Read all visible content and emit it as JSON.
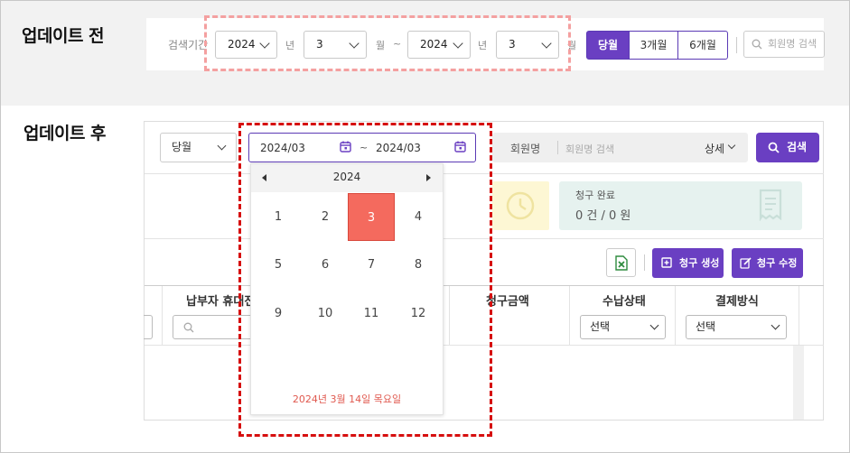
{
  "before": {
    "title": "업데이트 전",
    "period_label": "검색기간",
    "start_year": "2024",
    "year_unit": "년",
    "start_month": "3",
    "month_unit": "월",
    "range_sep": "~",
    "end_year": "2024",
    "end_month": "3",
    "period_buttons": [
      "당월",
      "3개월",
      "6개월"
    ],
    "member_search_placeholder": "회원명 검색"
  },
  "after": {
    "title": "업데이트 후",
    "period_select": "당월",
    "start": "2024/03",
    "range_sep": "~",
    "end": "2024/03",
    "member_label": "회원명",
    "member_search_placeholder": "회원명 검색",
    "detail_label": "상세",
    "search_button": "검색",
    "calendar": {
      "year": "2024",
      "months": [
        "1",
        "2",
        "3",
        "4",
        "5",
        "6",
        "7",
        "8",
        "9",
        "10",
        "11",
        "12"
      ],
      "selected_month": "3",
      "today": "2024년 3월 14일 목요일"
    },
    "card_complete": {
      "title": "청구 완료",
      "value": "0 건 / 0 원"
    },
    "buttons": {
      "create": "청구 생성",
      "edit": "청구 수정"
    },
    "columns": {
      "payer_phone": "납부자 휴대전",
      "amount": "청구금액",
      "status": "수납상태",
      "method": "결제방식"
    },
    "filters": {
      "status": "선택",
      "method": "선택"
    }
  },
  "colors": {
    "accent": "#6a3fc2",
    "selected_month": "#f46a5e",
    "highlight_old": "#f4a0a0",
    "highlight_new": "#d60f0f"
  }
}
